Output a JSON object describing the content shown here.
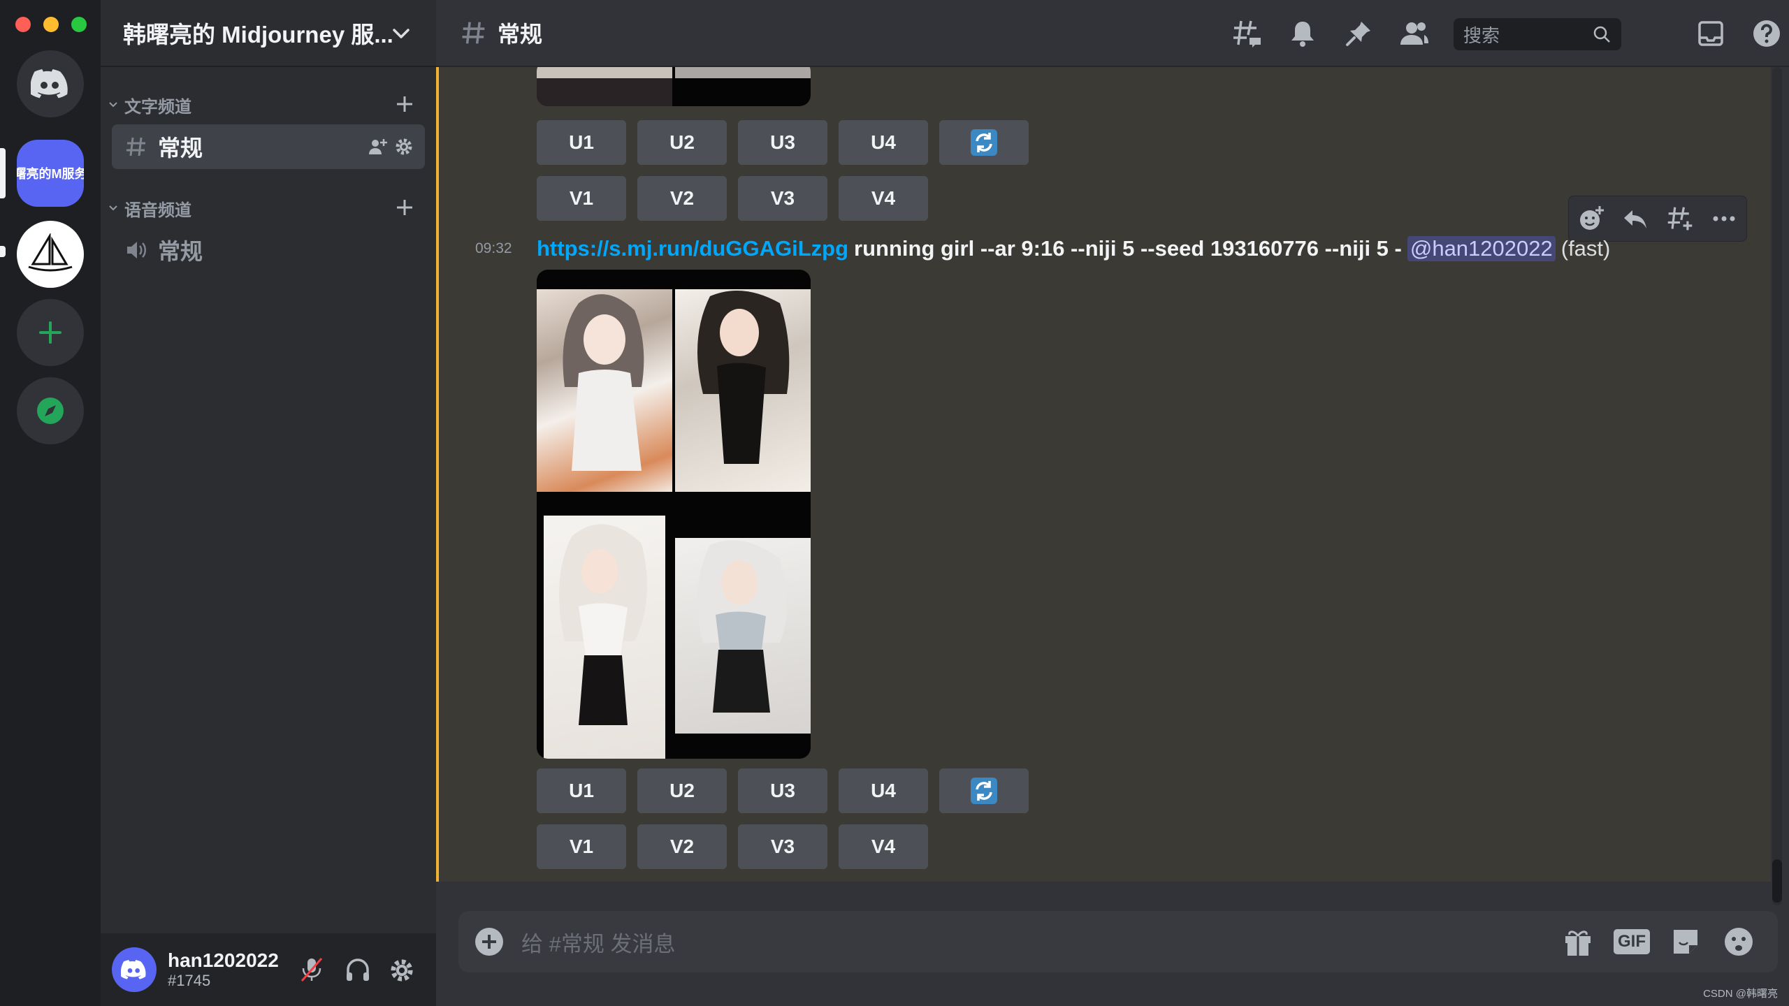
{
  "window": {
    "traffic_lights": [
      "#ff5f57",
      "#febc2e",
      "#28c840"
    ]
  },
  "servers": [
    {
      "name": "direct-messages",
      "icon": "discord-logo-icon"
    },
    {
      "name": "active-server",
      "label": "曙亮的M服务",
      "color": "#5865f2"
    },
    {
      "name": "midjourney",
      "icon": "midjourney-boat-icon"
    },
    {
      "name": "add-server",
      "icon": "plus-icon",
      "color": "#23a55a"
    },
    {
      "name": "explore",
      "icon": "compass-icon",
      "color": "#23a55a"
    }
  ],
  "guild": {
    "name": "韩曙亮的 Midjourney 服..."
  },
  "categories": {
    "text": {
      "label": "文字频道",
      "channel": "常规"
    },
    "voice": {
      "label": "语音频道",
      "channel": "常规"
    }
  },
  "user": {
    "name": "han1202022",
    "tag": "#1745"
  },
  "header": {
    "channel": "常规",
    "search_placeholder": "搜索"
  },
  "message": {
    "time": "09:32",
    "link": "https://s.mj.run/duGGAGiLzpg",
    "prompt": "running girl --ar 9:16 --niji 5 --seed 193160776 --niji 5 -",
    "mention": "@han1202022",
    "speed": "(fast)"
  },
  "buttons": {
    "upscale": [
      "U1",
      "U2",
      "U3",
      "U4"
    ],
    "variation": [
      "V1",
      "V2",
      "V3",
      "V4"
    ]
  },
  "composer": {
    "placeholder": "给 #常规 发消息",
    "gif_label": "GIF"
  },
  "watermark": "CSDN @韩曙亮",
  "colors": {
    "accent": "#5865f2",
    "link": "#00a8fc",
    "highlight_bar": "#f0b232",
    "green": "#23a55a"
  }
}
